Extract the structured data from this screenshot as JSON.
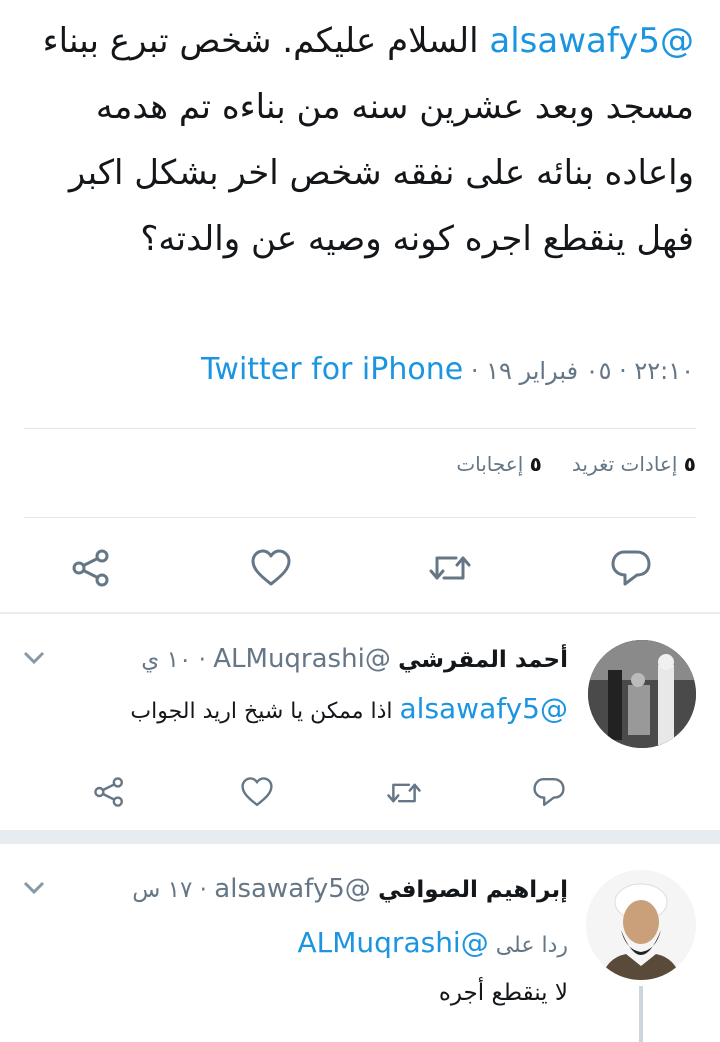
{
  "main_tweet": {
    "mention": "@alsawafy5",
    "text": " السلام عليكم. شخص تبرع ببناء مسجد وبعد عشرين سنه من بناءه تم هدمه واعاده بنائه على نفقه شخص اخر بشكل اكبر فهل ينقطع اجره كونه وصيه عن والدته؟",
    "time": "٢٢:١٠ · ٠٥ فبراير ١٩ · ",
    "source": "Twitter for iPhone",
    "retweets_count": "٥",
    "retweets_label": "إعادات تغريد",
    "likes_count": "٥",
    "likes_label": "إعجابات"
  },
  "replies": [
    {
      "name": "أحمد المقرشي",
      "handle": "@ALMuqrashi",
      "time": " · ١٠ ي",
      "mention": "@alsawafy5",
      "text": " اذا ممكن يا شيخ اريد الجواب"
    },
    {
      "name": "إبراهيم الصوافي",
      "handle": "@alsawafy5",
      "time": " · ١٧ س",
      "reply_to_label": "ردا على ",
      "reply_to_handle": "@ALMuqrashi",
      "text": "لا ينقطع أجره"
    }
  ],
  "icons": [
    "share-icon",
    "heart-icon",
    "retweet-icon",
    "reply-icon",
    "chevron-down-icon"
  ],
  "colors": {
    "link": "#1b95e0",
    "muted": "#657786",
    "divider": "#e1e8ed",
    "icon": "#657786"
  }
}
